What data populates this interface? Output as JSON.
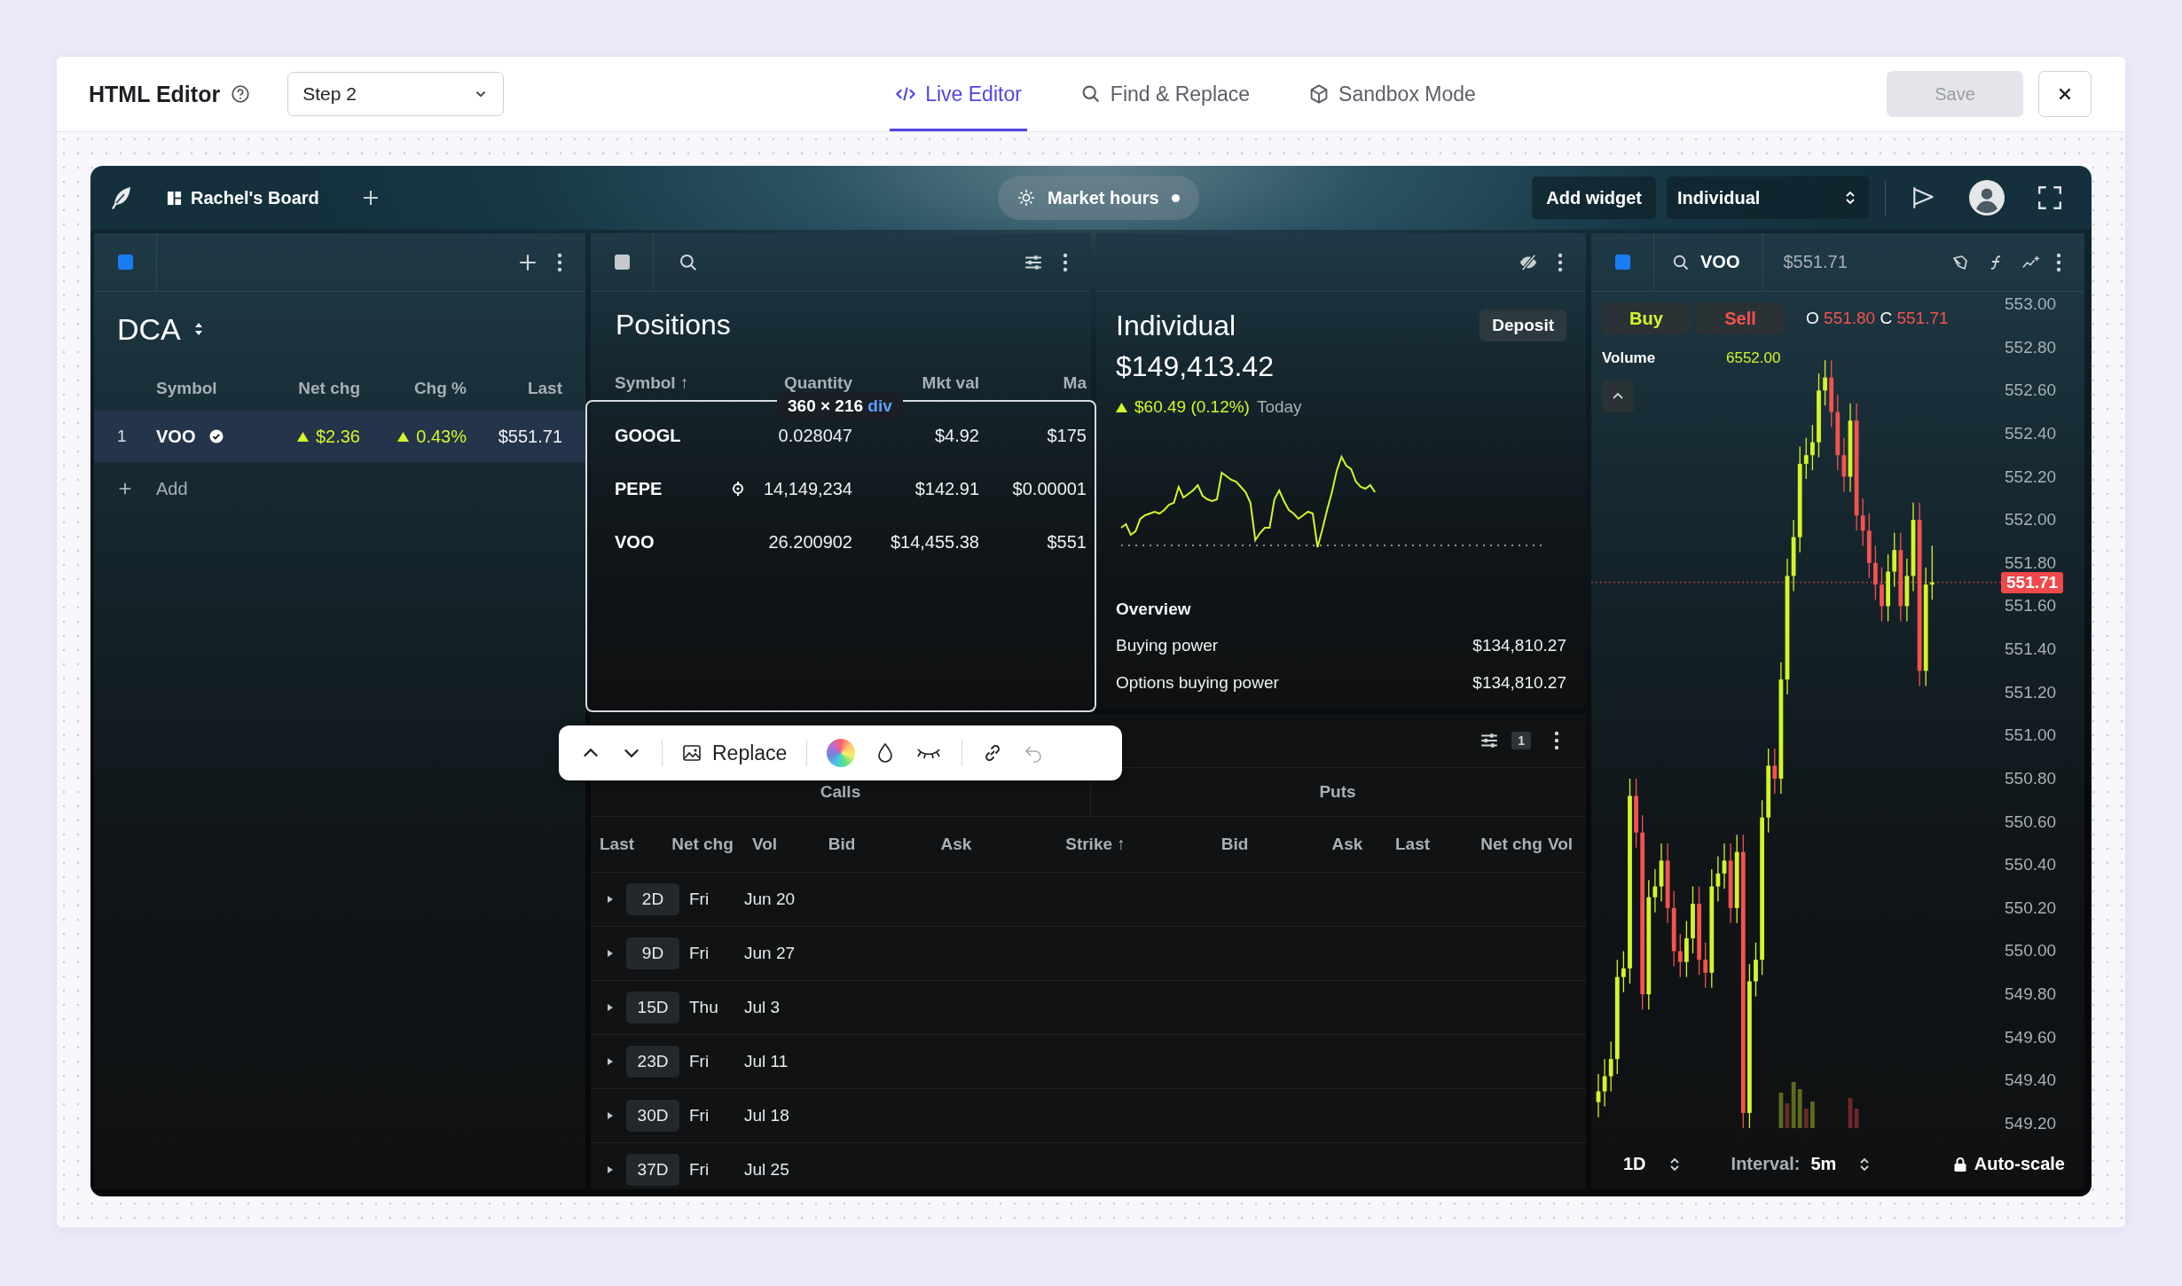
{
  "editor": {
    "title": "HTML Editor",
    "step_select": "Step 2",
    "save": {
      "label": "Save",
      "disabled": true
    },
    "tabs": [
      {
        "label": "Live Editor",
        "selected": true
      },
      {
        "label": "Find & Replace",
        "selected": false
      },
      {
        "label": "Sandbox Mode",
        "selected": false
      }
    ]
  },
  "board": {
    "name": "Rachel's Board",
    "market_hours": "Market hours",
    "add_widget": "Add widget",
    "account_select": "Individual"
  },
  "watchlist": {
    "title": "DCA",
    "columns": [
      "Symbol",
      "Net chg",
      "Chg %",
      "Last"
    ],
    "rows": [
      {
        "index": "1",
        "symbol": "VOO",
        "verified": true,
        "net_chg": "$2.36",
        "chg_pct": "0.43%",
        "last": "$551.71",
        "selected": true
      }
    ],
    "add_label": "Add"
  },
  "positions": {
    "title": "Positions",
    "columns": [
      "Symbol ↑",
      "Quantity",
      "Mkt val",
      "Ma"
    ],
    "rows": [
      {
        "symbol": "GOOGL",
        "kind": "stock",
        "quantity": "0.028047",
        "mkt_val": "$4.92",
        "column_4": "$175"
      },
      {
        "symbol": "PEPE",
        "kind": "crypto",
        "quantity": "14,149,234",
        "mkt_val": "$142.91",
        "column_4": "$0.00001"
      },
      {
        "symbol": "VOO",
        "kind": "stock",
        "quantity": "26.200902",
        "mkt_val": "$14,455.38",
        "column_4": "$551"
      }
    ],
    "selection_tag": {
      "size": "360 × 216",
      "element": "div"
    }
  },
  "account": {
    "title": "Individual",
    "value": "$149,413.42",
    "change": "$60.49 (0.12%)",
    "period": "Today",
    "deposit": "Deposit",
    "overview_title": "Overview",
    "overview": [
      {
        "label": "Buying power",
        "value": "$134,810.27"
      },
      {
        "label": "Options buying power",
        "value": "$134,810.27"
      }
    ]
  },
  "options": {
    "filter_count": "1",
    "groups": [
      "Calls",
      "Puts"
    ],
    "columns": [
      "Last",
      "Net chg",
      "Vol",
      "Bid",
      "Ask",
      "Strike ↑",
      "Bid",
      "Ask",
      "Last",
      "Net chg",
      "Vol"
    ],
    "expirations": [
      {
        "days": "2D",
        "weekday": "Fri",
        "date": "Jun 20"
      },
      {
        "days": "9D",
        "weekday": "Fri",
        "date": "Jun 27"
      },
      {
        "days": "15D",
        "weekday": "Thu",
        "date": "Jul 3"
      },
      {
        "days": "23D",
        "weekday": "Fri",
        "date": "Jul 11"
      },
      {
        "days": "30D",
        "weekday": "Fri",
        "date": "Jul 18"
      },
      {
        "days": "37D",
        "weekday": "Fri",
        "date": "Jul 25"
      }
    ]
  },
  "toolbar": {
    "replace": "Replace",
    "undo_disabled": true
  },
  "chart": {
    "symbol": "VOO",
    "price": "$551.71",
    "buy": "Buy",
    "sell": "Sell",
    "open_label": "O",
    "open": "551.80",
    "close_label": "C",
    "close": "551.71",
    "volume_label": "Volume",
    "volume": "6552.00",
    "chart_data": {
      "type": "candlestick",
      "ylim": [
        549.2,
        553.0
      ],
      "ref_lines": [
        {
          "axis": "y",
          "value": 551.71,
          "label": "551.71",
          "color": "#c2403d"
        }
      ],
      "yticks": [
        {
          "value": 553,
          "label": "553.00"
        },
        {
          "value": 552.8,
          "label": "552.80"
        },
        {
          "value": 552.6,
          "label": "552.60"
        },
        {
          "value": 552.4,
          "label": "552.40"
        },
        {
          "value": 552.2,
          "label": "552.20"
        },
        {
          "value": 552,
          "label": "552.00"
        },
        {
          "value": 551.8,
          "label": "551.80"
        },
        {
          "value": 551.6,
          "label": "551.60"
        },
        {
          "value": 551.4,
          "label": "551.40"
        },
        {
          "value": 551.2,
          "label": "551.20"
        },
        {
          "value": 551,
          "label": "551.00"
        },
        {
          "value": 550.8,
          "label": "550.80"
        },
        {
          "value": 550.6,
          "label": "550.60"
        },
        {
          "value": 550.4,
          "label": "550.40"
        },
        {
          "value": 550.2,
          "label": "550.20"
        },
        {
          "value": 550,
          "label": "550.00"
        },
        {
          "value": 549.8,
          "label": "549.80"
        },
        {
          "value": 549.6,
          "label": "549.60"
        },
        {
          "value": 549.4,
          "label": "549.40"
        },
        {
          "value": 549.2,
          "label": "549.20"
        }
      ],
      "ohlc": [
        [
          549.3,
          549.43,
          549.23,
          549.35
        ],
        [
          549.35,
          549.5,
          549.28,
          549.42
        ],
        [
          549.42,
          549.58,
          549.35,
          549.5
        ],
        [
          549.5,
          549.96,
          549.43,
          549.88
        ],
        [
          549.88,
          550.0,
          549.81,
          549.92
        ],
        [
          549.92,
          550.8,
          549.85,
          550.72
        ],
        [
          550.72,
          550.8,
          550.48,
          550.55
        ],
        [
          550.55,
          550.63,
          549.73,
          549.8
        ],
        [
          549.8,
          550.33,
          549.73,
          550.25
        ],
        [
          550.25,
          550.38,
          550.18,
          550.3
        ],
        [
          550.3,
          550.5,
          550.23,
          550.42
        ],
        [
          550.42,
          550.5,
          550.13,
          550.2
        ],
        [
          550.2,
          550.28,
          549.93,
          550.0
        ],
        [
          550.0,
          550.08,
          549.88,
          549.95
        ],
        [
          549.95,
          550.14,
          549.88,
          550.06
        ],
        [
          550.06,
          550.3,
          549.99,
          550.22
        ],
        [
          550.22,
          550.3,
          549.89,
          549.96
        ],
        [
          549.96,
          550.04,
          549.83,
          549.9
        ],
        [
          549.9,
          550.38,
          549.83,
          550.3
        ],
        [
          550.3,
          550.44,
          550.23,
          550.36
        ],
        [
          550.36,
          550.5,
          550.29,
          550.42
        ],
        [
          550.42,
          550.5,
          550.13,
          550.2
        ],
        [
          550.2,
          550.54,
          550.13,
          550.46
        ],
        [
          550.46,
          550.54,
          549.18,
          549.25
        ],
        [
          549.25,
          549.94,
          549.18,
          549.86
        ],
        [
          549.86,
          550.04,
          549.79,
          549.96
        ],
        [
          549.96,
          550.7,
          549.89,
          550.62
        ],
        [
          550.62,
          550.94,
          550.55,
          550.86
        ],
        [
          550.86,
          550.94,
          550.73,
          550.8
        ],
        [
          550.8,
          551.34,
          550.73,
          551.26
        ],
        [
          551.26,
          551.82,
          551.19,
          551.74
        ],
        [
          551.74,
          552.0,
          551.67,
          551.92
        ],
        [
          551.92,
          552.34,
          551.85,
          552.26
        ],
        [
          552.26,
          552.38,
          552.19,
          552.3
        ],
        [
          552.3,
          552.44,
          552.23,
          552.36
        ],
        [
          552.36,
          552.68,
          552.29,
          552.6
        ],
        [
          552.6,
          552.74,
          552.53,
          552.66
        ],
        [
          552.66,
          552.74,
          552.43,
          552.5
        ],
        [
          552.5,
          552.58,
          552.23,
          552.3
        ],
        [
          552.3,
          552.38,
          552.13,
          552.2
        ],
        [
          552.2,
          552.54,
          552.13,
          552.46
        ],
        [
          552.46,
          552.54,
          551.95,
          552.02
        ],
        [
          552.02,
          552.1,
          551.88,
          551.95
        ],
        [
          551.95,
          552.03,
          551.73,
          551.8
        ],
        [
          551.8,
          551.88,
          551.63,
          551.7
        ],
        [
          551.7,
          551.78,
          551.53,
          551.6
        ],
        [
          551.6,
          551.84,
          551.53,
          551.76
        ],
        [
          551.76,
          551.94,
          551.69,
          551.86
        ],
        [
          551.86,
          551.94,
          551.53,
          551.6
        ],
        [
          551.6,
          551.82,
          551.53,
          551.74
        ],
        [
          551.74,
          552.08,
          551.67,
          552.0
        ],
        [
          552.0,
          552.08,
          551.23,
          551.3
        ],
        [
          551.3,
          551.78,
          551.23,
          551.7
        ],
        [
          551.7,
          551.88,
          551.63,
          551.71
        ]
      ]
    },
    "range": "1D",
    "interval_label": "Interval:",
    "interval": "5m",
    "autoscale": "Auto-scale"
  }
}
